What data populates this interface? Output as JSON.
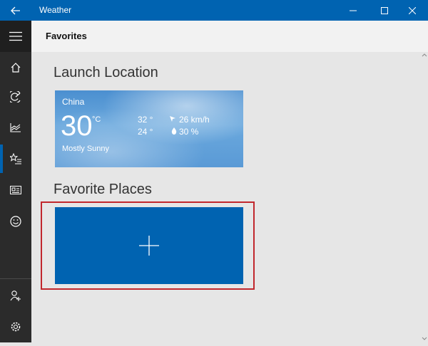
{
  "app": {
    "title": "Weather"
  },
  "titlebar": {
    "back_icon": "back-arrow-icon",
    "min_glyph": "—",
    "max_glyph": "☐",
    "close_glyph": "✕"
  },
  "sidebar": {
    "items": [
      {
        "name": "menu",
        "icon": "hamburger-icon"
      },
      {
        "name": "forecast",
        "icon": "home-icon"
      },
      {
        "name": "maps",
        "icon": "radar-icon"
      },
      {
        "name": "historical",
        "icon": "chart-icon"
      },
      {
        "name": "favorites",
        "icon": "star-list-icon",
        "active": true
      },
      {
        "name": "news",
        "icon": "news-icon"
      },
      {
        "name": "feedback",
        "icon": "smiley-icon"
      },
      {
        "name": "account",
        "icon": "user-add-icon"
      },
      {
        "name": "settings",
        "icon": "gear-icon"
      }
    ]
  },
  "header": {
    "title": "Favorites"
  },
  "launch": {
    "title": "Launch Location",
    "card": {
      "location": "China",
      "temp": "30",
      "unit": "°C",
      "condition": "Mostly Sunny",
      "high": "32 °",
      "low": "24 °",
      "wind": "26 km/h",
      "precip": "30 %"
    }
  },
  "favorites": {
    "title": "Favorite Places",
    "add_glyph": "+"
  },
  "colors": {
    "accent": "#0063b1",
    "sidebar": "#2b2b2b",
    "highlight": "#c1272d"
  }
}
